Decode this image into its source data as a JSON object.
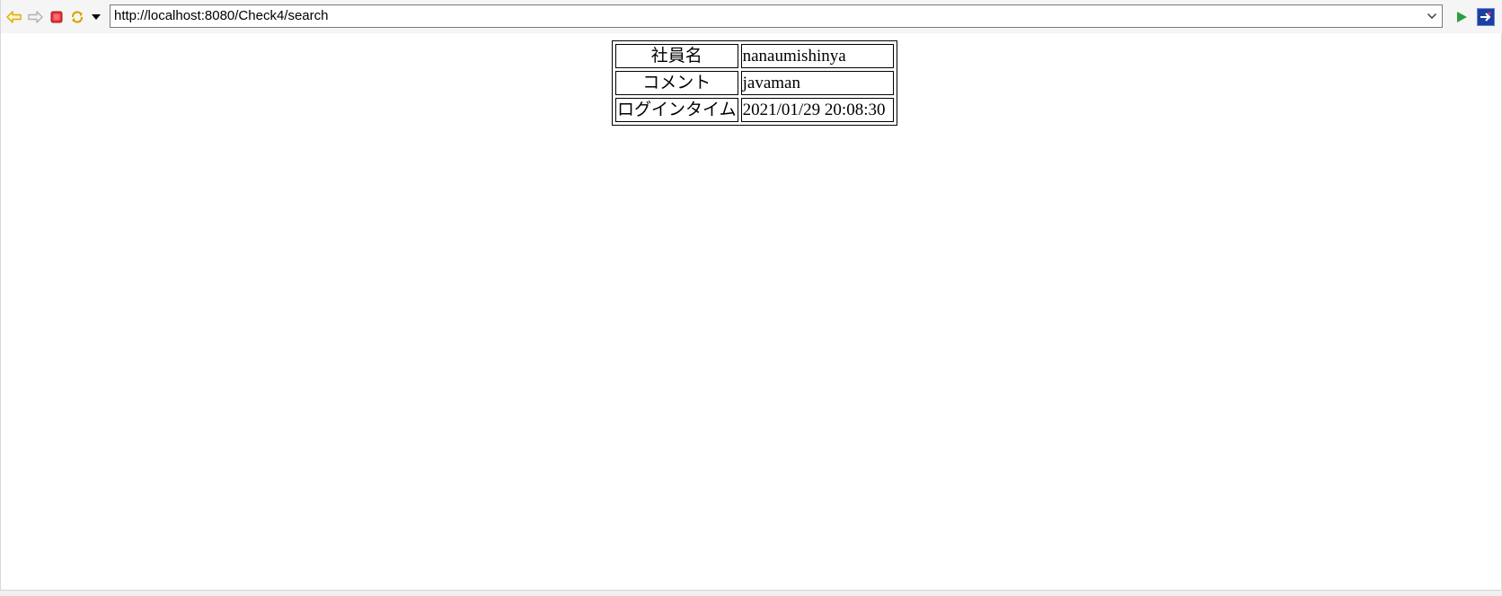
{
  "toolbar": {
    "back_icon": "back-arrow-icon",
    "forward_icon": "forward-arrow-icon",
    "stop_icon": "stop-icon",
    "refresh_icon": "refresh-icon",
    "menu_icon": "dropdown-triangle-icon",
    "go_icon": "go-play-icon",
    "open_external_icon": "open-external-browser-icon"
  },
  "address_bar": {
    "url": "http://localhost:8080/Check4/search"
  },
  "table": {
    "rows": [
      {
        "label": "社員名",
        "value": "nanaumishinya"
      },
      {
        "label": "コメント",
        "value": "javaman"
      },
      {
        "label": "ログインタイム",
        "value": "2021/01/29 20:08:30"
      }
    ]
  },
  "colors": {
    "back_arrow": "#e0a800",
    "forward_arrow": "#b0b0b0",
    "stop": "#e0303a",
    "refresh": "#d9a400",
    "go": "#2e9e3e",
    "external_bg": "#1f3f9f"
  }
}
